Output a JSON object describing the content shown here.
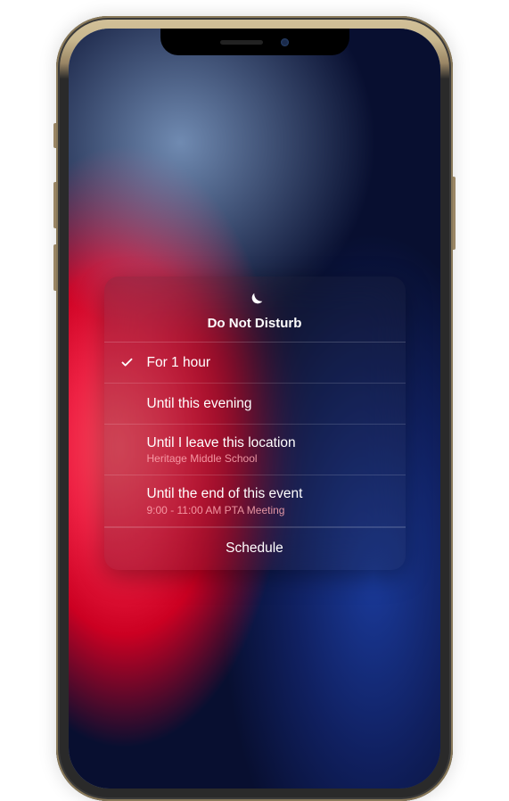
{
  "dnd": {
    "title": "Do Not Disturb",
    "options": [
      {
        "label": "For 1 hour",
        "sublabel": null,
        "selected": true
      },
      {
        "label": "Until this evening",
        "sublabel": null,
        "selected": false
      },
      {
        "label": "Until I leave this location",
        "sublabel": "Heritage Middle School",
        "selected": false
      },
      {
        "label": "Until the end of this event",
        "sublabel": "9:00 - 11:00 AM PTA Meeting",
        "selected": false
      }
    ],
    "schedule_label": "Schedule"
  },
  "icons": {
    "moon": "moon-icon",
    "checkmark": "checkmark-icon"
  }
}
